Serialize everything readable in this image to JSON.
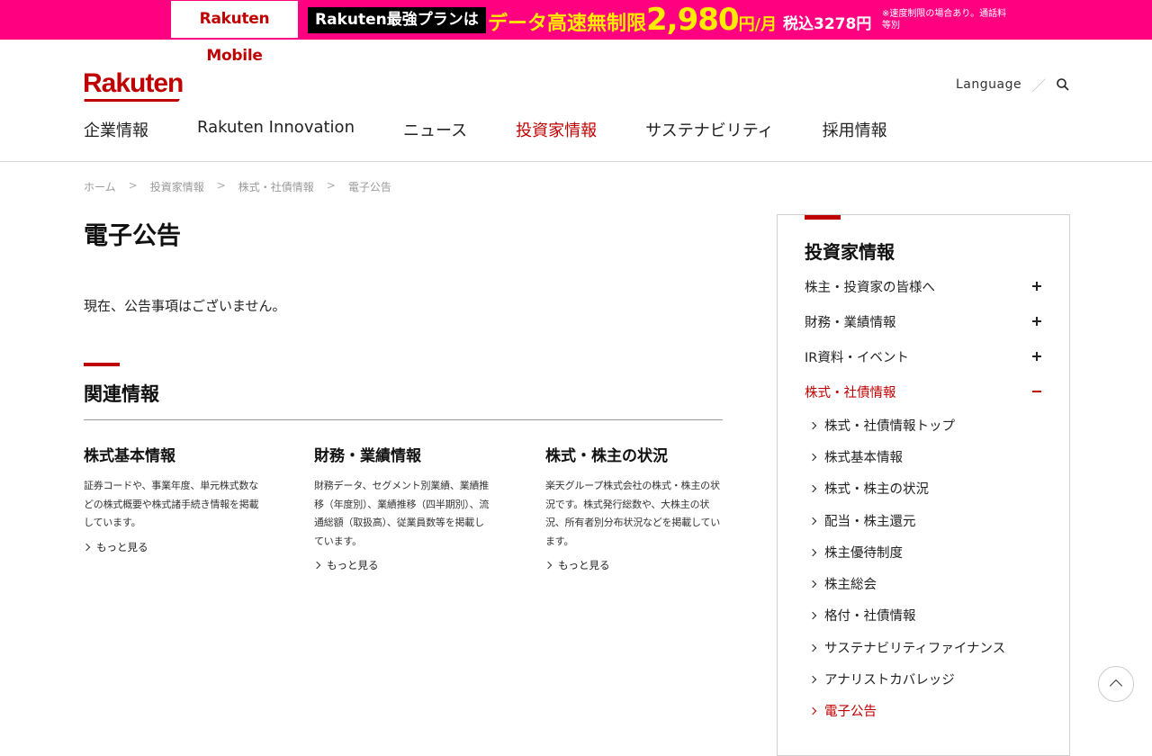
{
  "promo": {
    "logo": "Rakuten Mobile",
    "plan": "Rakuten最強プランは",
    "copy": "データ高速無制限",
    "price": "2,980",
    "unit": "円/月",
    "tax": "税込3278円",
    "note": "※速度制限の場合あり。通話料等別"
  },
  "header": {
    "logo": "Rakuten",
    "language": "Language",
    "slash": "／",
    "nav": [
      "企業情報",
      "Rakuten Innovation",
      "ニュース",
      "投資家情報",
      "サステナビリティ",
      "採用情報"
    ],
    "active_nav": "投資家情報"
  },
  "breadcrumb": [
    "ホーム",
    "投資家情報",
    "株式・社債情報",
    "電子公告"
  ],
  "main": {
    "title": "電子公告",
    "notice": "現在、公告事項はございません。",
    "related_title": "関連情報",
    "cards": [
      {
        "title": "株式基本情報",
        "desc": "証券コードや、事業年度、単元株式数などの株式概要や株式諸手続き情報を掲載しています。",
        "more": "もっと見る"
      },
      {
        "title": "財務・業績情報",
        "desc": "財務データ、セグメント別業績、業績推移（年度別）、業績推移（四半期別）、流通総額（取扱高）、従業員数等を掲載しています。",
        "more": "もっと見る"
      },
      {
        "title": "株式・株主の状況",
        "desc": "楽天グループ株式会社の株式・株主の状況です。株式発行総数や、大株主の状況、所有者別分布状況などを掲載しています。",
        "more": "もっと見る"
      }
    ]
  },
  "side": {
    "title": "投資家情報",
    "items": [
      {
        "label": "株主・投資家の皆様へ",
        "state": "collapsed"
      },
      {
        "label": "財務・業績情報",
        "state": "collapsed"
      },
      {
        "label": "IR資料・イベント",
        "state": "collapsed"
      },
      {
        "label": "株式・社債情報",
        "state": "expanded"
      }
    ],
    "sub_items": [
      "株式・社債情報トップ",
      "株式基本情報",
      "株式・株主の状況",
      "配当・株主還元",
      "株主優待制度",
      "株主総会",
      "格付・社債情報",
      "サステナビリティファイナンス",
      "アナリストカバレッジ",
      "電子公告"
    ],
    "active_sub": "電子公告"
  },
  "colors": {
    "brand": "#bf0000",
    "promo_bg": "#ff0080",
    "promo_yellow": "#ffeb00"
  }
}
